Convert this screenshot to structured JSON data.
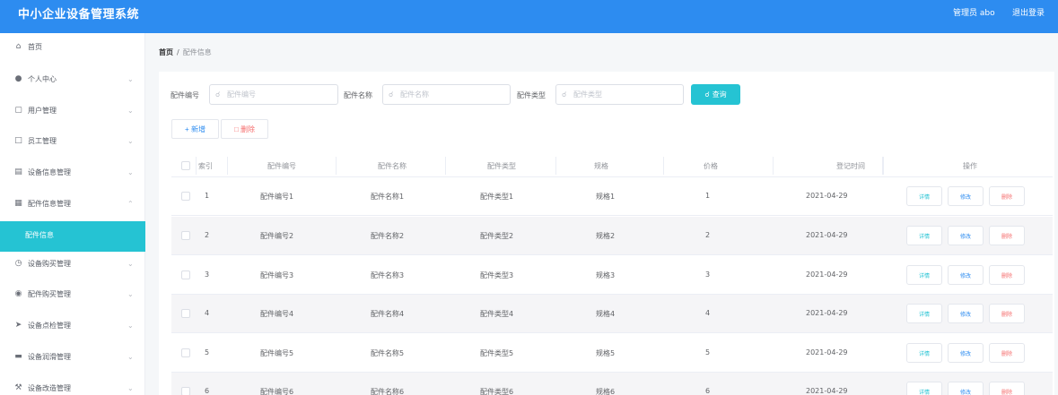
{
  "header": {
    "app_title": "中小企业设备管理系统",
    "admin_label": "管理员 abo",
    "logout_label": "退出登录"
  },
  "sidebar": {
    "items": [
      {
        "label": "首页",
        "icon": "home-icon",
        "arrow": ""
      },
      {
        "label": "个人中心",
        "icon": "user-icon",
        "arrow": "⌄"
      },
      {
        "label": "用户管理",
        "icon": "users-icon",
        "arrow": "⌄"
      },
      {
        "label": "员工管理",
        "icon": "staff-icon",
        "arrow": "⌄"
      },
      {
        "label": "设备信息管理",
        "icon": "device-icon",
        "arrow": "⌄"
      },
      {
        "label": "配件信息管理",
        "icon": "parts-icon",
        "arrow": "⌃"
      },
      {
        "label": "配件信息",
        "icon": "",
        "arrow": ""
      },
      {
        "label": "设备购买管理",
        "icon": "clock-icon",
        "arrow": "⌄"
      },
      {
        "label": "配件购买管理",
        "icon": "bulb-icon",
        "arrow": "⌄"
      },
      {
        "label": "设备点检管理",
        "icon": "send-icon",
        "arrow": "⌄"
      },
      {
        "label": "设备润滑管理",
        "icon": "monitor-icon",
        "arrow": "⌄"
      },
      {
        "label": "设备改造管理",
        "icon": "tool-icon",
        "arrow": "⌄"
      }
    ],
    "active_index": 6
  },
  "breadcrumb": {
    "home": "首页",
    "separator": "/",
    "current": "配件信息"
  },
  "search": {
    "fields": [
      {
        "label": "配件编号",
        "placeholder": "配件编号"
      },
      {
        "label": "配件名称",
        "placeholder": "配件名称"
      },
      {
        "label": "配件类型",
        "placeholder": "配件类型"
      }
    ],
    "query_label": "查询"
  },
  "toolbar": {
    "add_label": "+ 新增",
    "delete_label": "删除"
  },
  "table": {
    "columns": [
      "索引",
      "配件编号",
      "配件名称",
      "配件类型",
      "规格",
      "价格",
      "登记时间",
      "操作"
    ],
    "rows": [
      {
        "index": "1",
        "code": "配件编号1",
        "name": "配件名称1",
        "type": "配件类型1",
        "spec": "规格1",
        "price": "1",
        "date": "2021-04-29"
      },
      {
        "index": "2",
        "code": "配件编号2",
        "name": "配件名称2",
        "type": "配件类型2",
        "spec": "规格2",
        "price": "2",
        "date": "2021-04-29"
      },
      {
        "index": "3",
        "code": "配件编号3",
        "name": "配件名称3",
        "type": "配件类型3",
        "spec": "规格3",
        "price": "3",
        "date": "2021-04-29"
      },
      {
        "index": "4",
        "code": "配件编号4",
        "name": "配件名称4",
        "type": "配件类型4",
        "spec": "规格4",
        "price": "4",
        "date": "2021-04-29"
      },
      {
        "index": "5",
        "code": "配件编号5",
        "name": "配件名称5",
        "type": "配件类型5",
        "spec": "规格5",
        "price": "5",
        "date": "2021-04-29"
      },
      {
        "index": "6",
        "code": "配件编号6",
        "name": "配件名称6",
        "type": "配件类型6",
        "spec": "规格6",
        "price": "6",
        "date": "2021-04-29"
      }
    ],
    "actions": {
      "detail": "详情",
      "edit": "修改",
      "delete": "删除"
    }
  },
  "colors": {
    "header_bg": "#2d8cf0",
    "accent": "#25c3d3",
    "danger": "#f56c6c"
  }
}
